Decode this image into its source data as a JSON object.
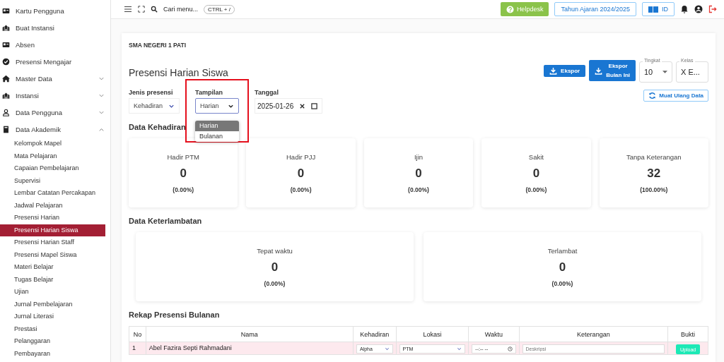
{
  "sidebar": {
    "items": [
      {
        "label": "Kartu Pengguna",
        "kind": "link"
      },
      {
        "label": "Buat Instansi",
        "kind": "link"
      },
      {
        "label": "Absen",
        "kind": "link"
      },
      {
        "label": "Presensi Mengajar",
        "kind": "link"
      },
      {
        "label": "Master Data",
        "kind": "group",
        "expanded": false
      },
      {
        "label": "Instansi",
        "kind": "group",
        "expanded": false
      },
      {
        "label": "Data Pengguna",
        "kind": "group",
        "expanded": false
      },
      {
        "label": "Data Akademik",
        "kind": "group",
        "expanded": true,
        "children": [
          {
            "label": "Kelompok Mapel",
            "selected": false
          },
          {
            "label": "Mata Pelajaran",
            "selected": false
          },
          {
            "label": "Capaian Pembelajaran",
            "selected": false
          },
          {
            "label": "Supervisi",
            "selected": false
          },
          {
            "label": "Lembar Catatan Percakapan",
            "selected": false
          },
          {
            "label": "Jadwal Pelajaran",
            "selected": false
          },
          {
            "label": "Presensi Harian",
            "selected": false
          },
          {
            "label": "Presensi Harian Siswa",
            "selected": true
          },
          {
            "label": "Presensi Harian Staff",
            "selected": false
          },
          {
            "label": "Presensi Mapel Siswa",
            "selected": false
          },
          {
            "label": "Materi Belajar",
            "selected": false
          },
          {
            "label": "Tugas Belajar",
            "selected": false
          },
          {
            "label": "Ujian",
            "selected": false
          },
          {
            "label": "Jurnal Pembelajaran",
            "selected": false
          },
          {
            "label": "Jurnal Literasi",
            "selected": false
          },
          {
            "label": "Prestasi",
            "selected": false
          },
          {
            "label": "Pelanggaran",
            "selected": false
          },
          {
            "label": "Pembayaran",
            "selected": false
          }
        ]
      }
    ]
  },
  "topbar": {
    "search": {
      "placeholder": "Cari menu..."
    },
    "shortcut": "CTRL + /",
    "helpdesk": "Helpdesk",
    "year": "Tahun Ajaran 2024/2025",
    "language": "ID"
  },
  "page": {
    "school": "SMA NEGERI 1 PATI",
    "title": "Presensi Harian Siswa",
    "actions": {
      "export": "Ekspor",
      "export_month": [
        "Ekspor",
        "Bulan Ini"
      ],
      "reload": "Muat Ulang Data"
    },
    "tingkat": {
      "label": "Tingkat",
      "value": "10"
    },
    "kelas": {
      "label": "Kelas",
      "value": "X E..."
    },
    "filters": {
      "jenis": {
        "label": "Jenis presensi",
        "value": "Kehadiran"
      },
      "tampilan": {
        "label": "Tampilan",
        "value": "Harian",
        "open": true,
        "options": [
          {
            "label": "Harian",
            "selected": true
          },
          {
            "label": "Bulanan",
            "selected": false
          }
        ]
      },
      "tanggal": {
        "label": "Tanggal",
        "value": "2025-01-26"
      }
    },
    "attendance": {
      "title": "Data Kehadiran",
      "cards": [
        {
          "label": "Hadir PTM",
          "value": "0",
          "percent": "(0.00%)"
        },
        {
          "label": "Hadir PJJ",
          "value": "0",
          "percent": "(0.00%)"
        },
        {
          "label": "Ijin",
          "value": "0",
          "percent": "(0.00%)"
        },
        {
          "label": "Sakit",
          "value": "0",
          "percent": "(0.00%)"
        },
        {
          "label": "Tanpa Keterangan",
          "value": "32",
          "percent": "(100.00%)"
        }
      ]
    },
    "lateness": {
      "title": "Data Keterlambatan",
      "cards": [
        {
          "label": "Tepat waktu",
          "value": "0",
          "percent": "(0.00%)"
        },
        {
          "label": "Terlambat",
          "value": "0",
          "percent": "(0.00%)"
        }
      ]
    },
    "recap": {
      "title": "Rekap Presensi Bulanan",
      "columns": [
        "No",
        "Nama",
        "Kehadiran",
        "Lokasi",
        "Waktu",
        "Keterangan",
        "Bukti"
      ],
      "rows": [
        {
          "no": "1",
          "name": "Abel Fazira Septi Rahmadani",
          "kehadiran": "Alpha",
          "lokasi": "PTM",
          "waktu": "--:-- --",
          "keterangan_placeholder": "Deskripsi",
          "upload": "Upload"
        }
      ]
    }
  }
}
